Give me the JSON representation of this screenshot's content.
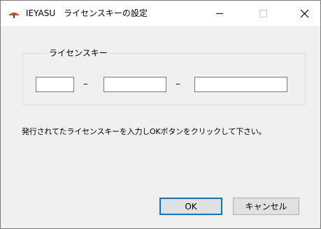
{
  "window": {
    "title": "IEYASU　ライセンスキーの設定",
    "controls": {
      "minimize": "minimize-icon",
      "maximize": "maximize-icon",
      "close": "close-icon"
    }
  },
  "license_group": {
    "legend": "ライセンスキー",
    "fields": [
      {
        "value": "",
        "placeholder": ""
      },
      {
        "value": "",
        "placeholder": ""
      },
      {
        "value": "",
        "placeholder": ""
      }
    ],
    "separator": "–"
  },
  "instructions": "発行されてたライセンスキーを入力しOKボタンをクリックして下さい。",
  "buttons": {
    "ok": "OK",
    "cancel": "キャンセル"
  },
  "colors": {
    "accent": "#0078d7",
    "app_icon": "#c8502a"
  }
}
